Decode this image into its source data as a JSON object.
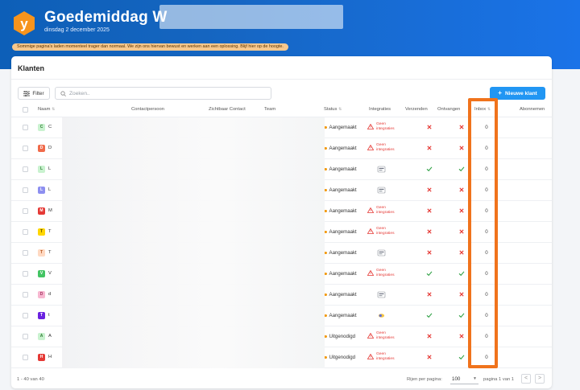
{
  "header": {
    "greeting": "Goedemiddag W",
    "date": "dinsdag 2 december 2025",
    "logo_letter": "y",
    "notice": "Sommige pagina's laden momenteel trager dan normaal. We zijn ons hiervan bewust en werken aan een oplossing. Blijf hier op de hoogte."
  },
  "card": {
    "title": "Klanten",
    "filter_label": "Filter",
    "search_placeholder": "Zoeken..",
    "new_button_label": "Nieuwe klant"
  },
  "table": {
    "columns": {
      "naam": "Naam",
      "contactpersoon": "Contactpersoon",
      "zichtbaar_contact": "Zichtbaar Contact",
      "team": "Team",
      "status": "Status",
      "integraties": "Integraties",
      "verzenden": "Verzenden",
      "ontvangen": "Ontvangen",
      "inbox": "Inbox",
      "abonnement": "Abonnemen"
    },
    "rows": [
      {
        "letter": "C",
        "name": "C",
        "avatar_bg": "#c9f2cf",
        "avatar_fg": "#2e7d32",
        "status": "Aangemaakt",
        "integration": "none",
        "integration_text": "Geen integraties",
        "verzenden": false,
        "ontvangen": false,
        "inbox": "0"
      },
      {
        "letter": "D",
        "name": "D",
        "avatar_bg": "#f06a4a",
        "avatar_fg": "#ffffff",
        "status": "Aangemaakt",
        "integration": "none",
        "integration_text": "Geen integraties",
        "verzenden": false,
        "ontvangen": false,
        "inbox": "0"
      },
      {
        "letter": "L",
        "name": "L",
        "avatar_bg": "#c9f2cf",
        "avatar_fg": "#2e7d32",
        "status": "Aangemaakt",
        "integration": "icon",
        "integration_text": "",
        "verzenden": true,
        "ontvangen": true,
        "inbox": "0"
      },
      {
        "letter": "L",
        "name": "L",
        "avatar_bg": "#8d8ff0",
        "avatar_fg": "#ffffff",
        "status": "Aangemaakt",
        "integration": "icon",
        "integration_text": "",
        "verzenden": false,
        "ontvangen": false,
        "inbox": "0"
      },
      {
        "letter": "M",
        "name": "M",
        "avatar_bg": "#e53935",
        "avatar_fg": "#ffffff",
        "status": "Aangemaakt",
        "integration": "none",
        "integration_text": "Geen integraties",
        "verzenden": false,
        "ontvangen": false,
        "inbox": "0"
      },
      {
        "letter": "T",
        "name": "T",
        "avatar_bg": "#ffd600",
        "avatar_fg": "#5d4a00",
        "status": "Aangemaakt",
        "integration": "none",
        "integration_text": "Geen integraties",
        "verzenden": false,
        "ontvangen": false,
        "inbox": "0"
      },
      {
        "letter": "T",
        "name": "T",
        "avatar_bg": "#ffd9c2",
        "avatar_fg": "#b5521b",
        "status": "Aangemaakt",
        "integration": "icon",
        "integration_text": "",
        "verzenden": false,
        "ontvangen": false,
        "inbox": "0"
      },
      {
        "letter": "V",
        "name": "V",
        "avatar_bg": "#43c463",
        "avatar_fg": "#ffffff",
        "status": "Aangemaakt",
        "integration": "none",
        "integration_text": "Geen integraties",
        "verzenden": true,
        "ontvangen": true,
        "inbox": "0"
      },
      {
        "letter": "D",
        "name": "d",
        "avatar_bg": "#f7b7d0",
        "avatar_fg": "#a0305c",
        "status": "Aangemaakt",
        "integration": "icon",
        "integration_text": "",
        "verzenden": false,
        "ontvangen": false,
        "inbox": "0"
      },
      {
        "letter": "T",
        "name": "t",
        "avatar_bg": "#6a22e0",
        "avatar_fg": "#ffffff",
        "status": "Aangemaakt",
        "integration": "icon2",
        "integration_text": "",
        "verzenden": true,
        "ontvangen": true,
        "inbox": "0"
      },
      {
        "letter": "A",
        "name": "A",
        "avatar_bg": "#c9f2cf",
        "avatar_fg": "#2e7d32",
        "status": "Uitgenodigd",
        "integration": "none",
        "integration_text": "Geen integraties",
        "verzenden": false,
        "ontvangen": false,
        "inbox": "0"
      },
      {
        "letter": "H",
        "name": "H",
        "avatar_bg": "#e53935",
        "avatar_fg": "#ffffff",
        "status": "Uitgenodigd",
        "integration": "none",
        "integration_text": "Geen integraties",
        "verzenden": false,
        "ontvangen": true,
        "inbox": "0"
      }
    ]
  },
  "footer": {
    "range": "1 - 40 van 40",
    "rows_per_page_label": "Rijen per pagina:",
    "rows_per_page_value": "100",
    "page_label": "pagina 1 van 1",
    "prev_symbol": "<",
    "next_symbol": ">"
  },
  "colors": {
    "accent": "#2196f3",
    "highlight": "#f0731c",
    "status_dot": "#f39c12",
    "check": "#2ea043",
    "cross": "#e53935"
  }
}
